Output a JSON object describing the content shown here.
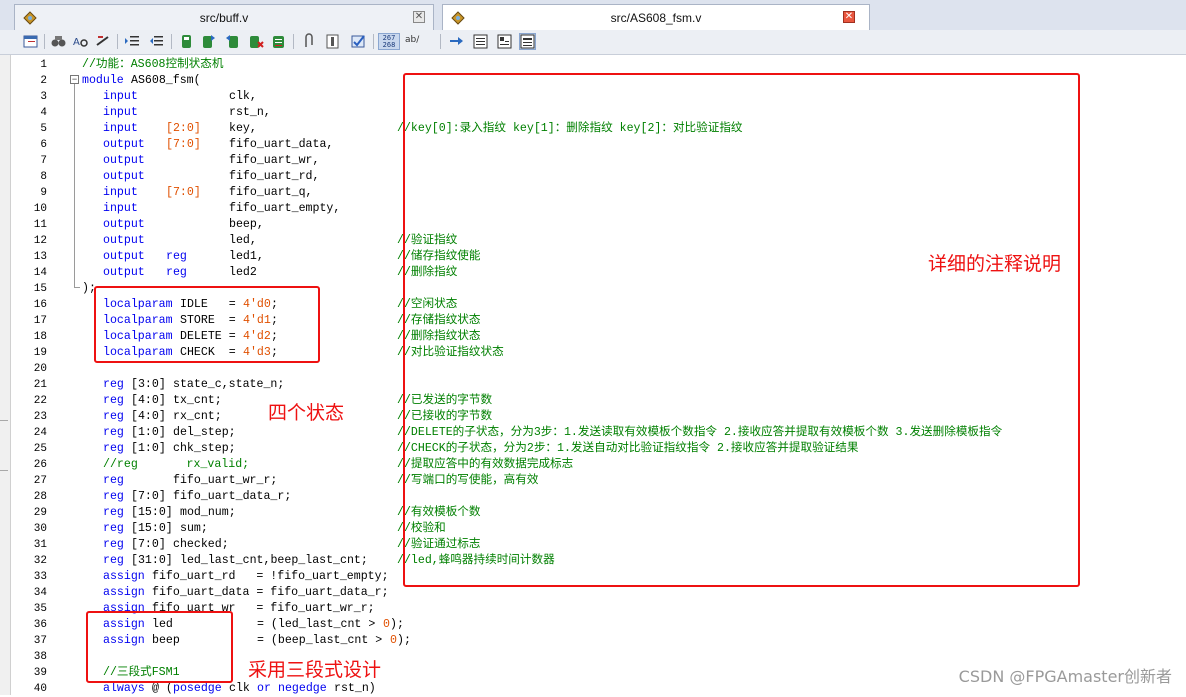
{
  "tabs": [
    {
      "title": "src/buff.v",
      "close_icon": "close-icon",
      "file_icon": "verilog-file-icon"
    },
    {
      "title": "src/AS608_fsm.v",
      "close_icon": "close-icon",
      "file_icon": "verilog-file-icon"
    }
  ],
  "toolbar": {
    "icons": [
      "window-list-icon",
      "find-icon",
      "find-in-files-icon",
      "replace-icon",
      "indent-icon",
      "unindent-icon",
      "bookmark-icon",
      "next-bookmark-icon",
      "prev-bookmark-icon",
      "clear-bookmarks-icon",
      "bookmark-list-icon",
      "paperclip-icon",
      "column-select-icon",
      "spell-check-icon",
      "line-numbers-icon",
      "word-wrap-icon",
      "goto-icon",
      "view-icon-1",
      "view-icon-2",
      "view-icon-3"
    ],
    "line_numbers_label": "267 268",
    "word_wrap_label": "ab/"
  },
  "colors": {
    "keyword": "#0000f0",
    "number": "#e05000",
    "comment": "#008000",
    "annotation": "#ee1111"
  },
  "code_lines": [
    {
      "n": "1",
      "tokens": [
        {
          "t": "//功能：AS608控制状态机",
          "c": "cm",
          "col": 0
        }
      ]
    },
    {
      "n": "2",
      "tokens": [
        {
          "t": "module",
          "c": "kw",
          "col": 0
        },
        {
          "t": "AS608_fsm(",
          "c": "",
          "col": 7
        }
      ]
    },
    {
      "n": "3",
      "tokens": [
        {
          "t": "input",
          "c": "kw",
          "col": 3
        },
        {
          "t": "clk,",
          "c": "",
          "col": 21
        }
      ]
    },
    {
      "n": "4",
      "tokens": [
        {
          "t": "input",
          "c": "kw",
          "col": 3
        },
        {
          "t": "rst_n,",
          "c": "",
          "col": 21
        }
      ]
    },
    {
      "n": "5",
      "tokens": [
        {
          "t": "input",
          "c": "kw",
          "col": 3
        },
        {
          "t": "[2:0]",
          "c": "num",
          "col": 12
        },
        {
          "t": "key,",
          "c": "",
          "col": 21
        },
        {
          "t": "//key[0]:录入指纹 key[1]：删除指纹 key[2]：对比验证指纹",
          "c": "cm",
          "col": 45
        }
      ]
    },
    {
      "n": "6",
      "tokens": [
        {
          "t": "output",
          "c": "kw",
          "col": 3
        },
        {
          "t": "[7:0]",
          "c": "num",
          "col": 12
        },
        {
          "t": "fifo_uart_data,",
          "c": "",
          "col": 21
        }
      ]
    },
    {
      "n": "7",
      "tokens": [
        {
          "t": "output",
          "c": "kw",
          "col": 3
        },
        {
          "t": "fifo_uart_wr,",
          "c": "",
          "col": 21
        }
      ]
    },
    {
      "n": "8",
      "tokens": [
        {
          "t": "output",
          "c": "kw",
          "col": 3
        },
        {
          "t": "fifo_uart_rd,",
          "c": "",
          "col": 21
        }
      ]
    },
    {
      "n": "9",
      "tokens": [
        {
          "t": "input",
          "c": "kw",
          "col": 3
        },
        {
          "t": "[7:0]",
          "c": "num",
          "col": 12
        },
        {
          "t": "fifo_uart_q,",
          "c": "",
          "col": 21
        }
      ]
    },
    {
      "n": "10",
      "tokens": [
        {
          "t": "input",
          "c": "kw",
          "col": 3
        },
        {
          "t": "fifo_uart_empty,",
          "c": "",
          "col": 21
        }
      ]
    },
    {
      "n": "11",
      "tokens": [
        {
          "t": "output",
          "c": "kw",
          "col": 3
        },
        {
          "t": "beep,",
          "c": "",
          "col": 21
        }
      ]
    },
    {
      "n": "12",
      "tokens": [
        {
          "t": "output",
          "c": "kw",
          "col": 3
        },
        {
          "t": "led,",
          "c": "",
          "col": 21
        },
        {
          "t": "//验证指纹",
          "c": "cm",
          "col": 45
        }
      ]
    },
    {
      "n": "13",
      "tokens": [
        {
          "t": "output",
          "c": "kw",
          "col": 3
        },
        {
          "t": "reg",
          "c": "kw",
          "col": 12
        },
        {
          "t": "led1,",
          "c": "",
          "col": 21
        },
        {
          "t": "//储存指纹使能",
          "c": "cm",
          "col": 45
        }
      ]
    },
    {
      "n": "14",
      "tokens": [
        {
          "t": "output",
          "c": "kw",
          "col": 3
        },
        {
          "t": "reg",
          "c": "kw",
          "col": 12
        },
        {
          "t": "led2",
          "c": "",
          "col": 21
        },
        {
          "t": "//删除指纹",
          "c": "cm",
          "col": 45
        }
      ]
    },
    {
      "n": "15",
      "tokens": [
        {
          "t": ");",
          "c": "",
          "col": 0
        }
      ]
    },
    {
      "n": "16",
      "tokens": [
        {
          "t": "localparam",
          "c": "kw",
          "col": 3
        },
        {
          "t": "IDLE   =",
          "c": "",
          "col": 14
        },
        {
          "t": "4'd0",
          "c": "num",
          "col": 23
        },
        {
          "t": ";",
          "c": "",
          "col": 27
        },
        {
          "t": "//空闲状态",
          "c": "cm",
          "col": 45
        }
      ]
    },
    {
      "n": "17",
      "tokens": [
        {
          "t": "localparam",
          "c": "kw",
          "col": 3
        },
        {
          "t": "STORE  =",
          "c": "",
          "col": 14
        },
        {
          "t": "4'd1",
          "c": "num",
          "col": 23
        },
        {
          "t": ";",
          "c": "",
          "col": 27
        },
        {
          "t": "//存储指纹状态",
          "c": "cm",
          "col": 45
        }
      ]
    },
    {
      "n": "18",
      "tokens": [
        {
          "t": "localparam",
          "c": "kw",
          "col": 3
        },
        {
          "t": "DELETE =",
          "c": "",
          "col": 14
        },
        {
          "t": "4'd2",
          "c": "num",
          "col": 23
        },
        {
          "t": ";",
          "c": "",
          "col": 27
        },
        {
          "t": "//删除指纹状态",
          "c": "cm",
          "col": 45
        }
      ]
    },
    {
      "n": "19",
      "tokens": [
        {
          "t": "localparam",
          "c": "kw",
          "col": 3
        },
        {
          "t": "CHECK  =",
          "c": "",
          "col": 14
        },
        {
          "t": "4'd3",
          "c": "num",
          "col": 23
        },
        {
          "t": ";",
          "c": "",
          "col": 27
        },
        {
          "t": "//对比验证指纹状态",
          "c": "cm",
          "col": 45
        }
      ]
    },
    {
      "n": "20",
      "tokens": []
    },
    {
      "n": "21",
      "tokens": [
        {
          "t": "reg",
          "c": "kw",
          "col": 3
        },
        {
          "t": "[3:0]",
          "c": "",
          "col": 7
        },
        {
          "t": "state_c,state_n;",
          "c": "",
          "col": 13
        }
      ]
    },
    {
      "n": "22",
      "tokens": [
        {
          "t": "reg",
          "c": "kw",
          "col": 3
        },
        {
          "t": "[4:0]",
          "c": "",
          "col": 7
        },
        {
          "t": "tx_cnt;",
          "c": "",
          "col": 13
        },
        {
          "t": "//已发送的字节数",
          "c": "cm",
          "col": 45
        }
      ]
    },
    {
      "n": "23",
      "tokens": [
        {
          "t": "reg",
          "c": "kw",
          "col": 3
        },
        {
          "t": "[4:0]",
          "c": "",
          "col": 7
        },
        {
          "t": "rx_cnt;",
          "c": "",
          "col": 13
        },
        {
          "t": "//已接收的字节数",
          "c": "cm",
          "col": 45
        }
      ]
    },
    {
      "n": "24",
      "tokens": [
        {
          "t": "reg",
          "c": "kw",
          "col": 3
        },
        {
          "t": "[1:0]",
          "c": "",
          "col": 7
        },
        {
          "t": "del_step;",
          "c": "",
          "col": 13
        },
        {
          "t": "//DELETE的子状态，分为3步：1.发送读取有效模板个数指令 2.接收应答并提取有效模板个数 3.发送删除模板指令",
          "c": "cm",
          "col": 45
        }
      ]
    },
    {
      "n": "25",
      "tokens": [
        {
          "t": "reg",
          "c": "kw",
          "col": 3
        },
        {
          "t": "[1:0]",
          "c": "",
          "col": 7
        },
        {
          "t": "chk_step;",
          "c": "",
          "col": 13
        },
        {
          "t": "//CHECK的子状态，分为2步：1.发送自动对比验证指纹指令 2.接收应答并提取验证结果",
          "c": "cm",
          "col": 45
        }
      ]
    },
    {
      "n": "26",
      "tokens": [
        {
          "t": "//reg       rx_valid;",
          "c": "cm",
          "col": 3
        },
        {
          "t": "//提取应答中的有效数据完成标志",
          "c": "cm",
          "col": 45
        }
      ]
    },
    {
      "n": "27",
      "tokens": [
        {
          "t": "reg",
          "c": "kw",
          "col": 3
        },
        {
          "t": "fifo_uart_wr_r;",
          "c": "",
          "col": 13
        },
        {
          "t": "//写端口的写使能，高有效",
          "c": "cm",
          "col": 45
        }
      ]
    },
    {
      "n": "28",
      "tokens": [
        {
          "t": "reg",
          "c": "kw",
          "col": 3
        },
        {
          "t": "[7:0]",
          "c": "",
          "col": 7
        },
        {
          "t": "fifo_uart_data_r;",
          "c": "",
          "col": 13
        }
      ]
    },
    {
      "n": "29",
      "tokens": [
        {
          "t": "reg",
          "c": "kw",
          "col": 3
        },
        {
          "t": "[15:0]",
          "c": "",
          "col": 7
        },
        {
          "t": "mod_num;",
          "c": "",
          "col": 14
        },
        {
          "t": "//有效模板个数",
          "c": "cm",
          "col": 45
        }
      ]
    },
    {
      "n": "30",
      "tokens": [
        {
          "t": "reg",
          "c": "kw",
          "col": 3
        },
        {
          "t": "[15:0]",
          "c": "",
          "col": 7
        },
        {
          "t": "sum;",
          "c": "",
          "col": 14
        },
        {
          "t": "//校验和",
          "c": "cm",
          "col": 45
        }
      ]
    },
    {
      "n": "31",
      "tokens": [
        {
          "t": "reg",
          "c": "kw",
          "col": 3
        },
        {
          "t": "[7:0]",
          "c": "",
          "col": 7
        },
        {
          "t": "checked;",
          "c": "",
          "col": 13
        },
        {
          "t": "//验证通过标志",
          "c": "cm",
          "col": 45
        }
      ]
    },
    {
      "n": "32",
      "tokens": [
        {
          "t": "reg",
          "c": "kw",
          "col": 3
        },
        {
          "t": "[31:0]",
          "c": "",
          "col": 7
        },
        {
          "t": "led_last_cnt,beep_last_cnt;",
          "c": "",
          "col": 14
        },
        {
          "t": "//led,蜂鸣器持续时间计数器",
          "c": "cm",
          "col": 45
        }
      ]
    },
    {
      "n": "33",
      "tokens": [
        {
          "t": "assign",
          "c": "kw",
          "col": 3
        },
        {
          "t": "fifo_uart_rd   = !fifo_uart_empty;",
          "c": "",
          "col": 10
        }
      ]
    },
    {
      "n": "34",
      "tokens": [
        {
          "t": "assign",
          "c": "kw",
          "col": 3
        },
        {
          "t": "fifo_uart_data = fifo_uart_data_r;",
          "c": "",
          "col": 10
        }
      ]
    },
    {
      "n": "35",
      "tokens": [
        {
          "t": "assign",
          "c": "kw",
          "col": 3
        },
        {
          "t": "fifo_uart_wr   = fifo_uart_wr_r;",
          "c": "",
          "col": 10
        }
      ]
    },
    {
      "n": "36",
      "tokens": [
        {
          "t": "assign",
          "c": "kw",
          "col": 3
        },
        {
          "t": "led",
          "c": "",
          "col": 10
        },
        {
          "t": "= (led_last_cnt >",
          "c": "",
          "col": 25
        },
        {
          "t": "0",
          "c": "num",
          "col": 43
        },
        {
          "t": ");",
          "c": "",
          "col": 44
        }
      ]
    },
    {
      "n": "37",
      "tokens": [
        {
          "t": "assign",
          "c": "kw",
          "col": 3
        },
        {
          "t": "beep",
          "c": "",
          "col": 10
        },
        {
          "t": "= (beep_last_cnt >",
          "c": "",
          "col": 25
        },
        {
          "t": "0",
          "c": "num",
          "col": 44
        },
        {
          "t": ");",
          "c": "",
          "col": 45
        }
      ]
    },
    {
      "n": "38",
      "tokens": []
    },
    {
      "n": "39",
      "tokens": [
        {
          "t": "//三段式FSM1",
          "c": "cm",
          "col": 3
        }
      ]
    },
    {
      "n": "40",
      "tokens": [
        {
          "t": "always",
          "c": "kw",
          "col": 3
        },
        {
          "t": "@ (",
          "c": "",
          "col": 10
        },
        {
          "t": "posedge",
          "c": "kw",
          "col": 13
        },
        {
          "t": "clk",
          "c": "",
          "col": 21
        },
        {
          "t": "or",
          "c": "kw",
          "col": 25
        },
        {
          "t": "negedge",
          "c": "kw",
          "col": 28
        },
        {
          "t": "rst_n)",
          "c": "",
          "col": 36
        }
      ]
    }
  ],
  "annotations": {
    "comments_label": "详细的注释说明",
    "states_label": "四个状态",
    "fsm_label": "采用三段式设计"
  },
  "watermark": "CSDN @FPGAmaster创新者"
}
